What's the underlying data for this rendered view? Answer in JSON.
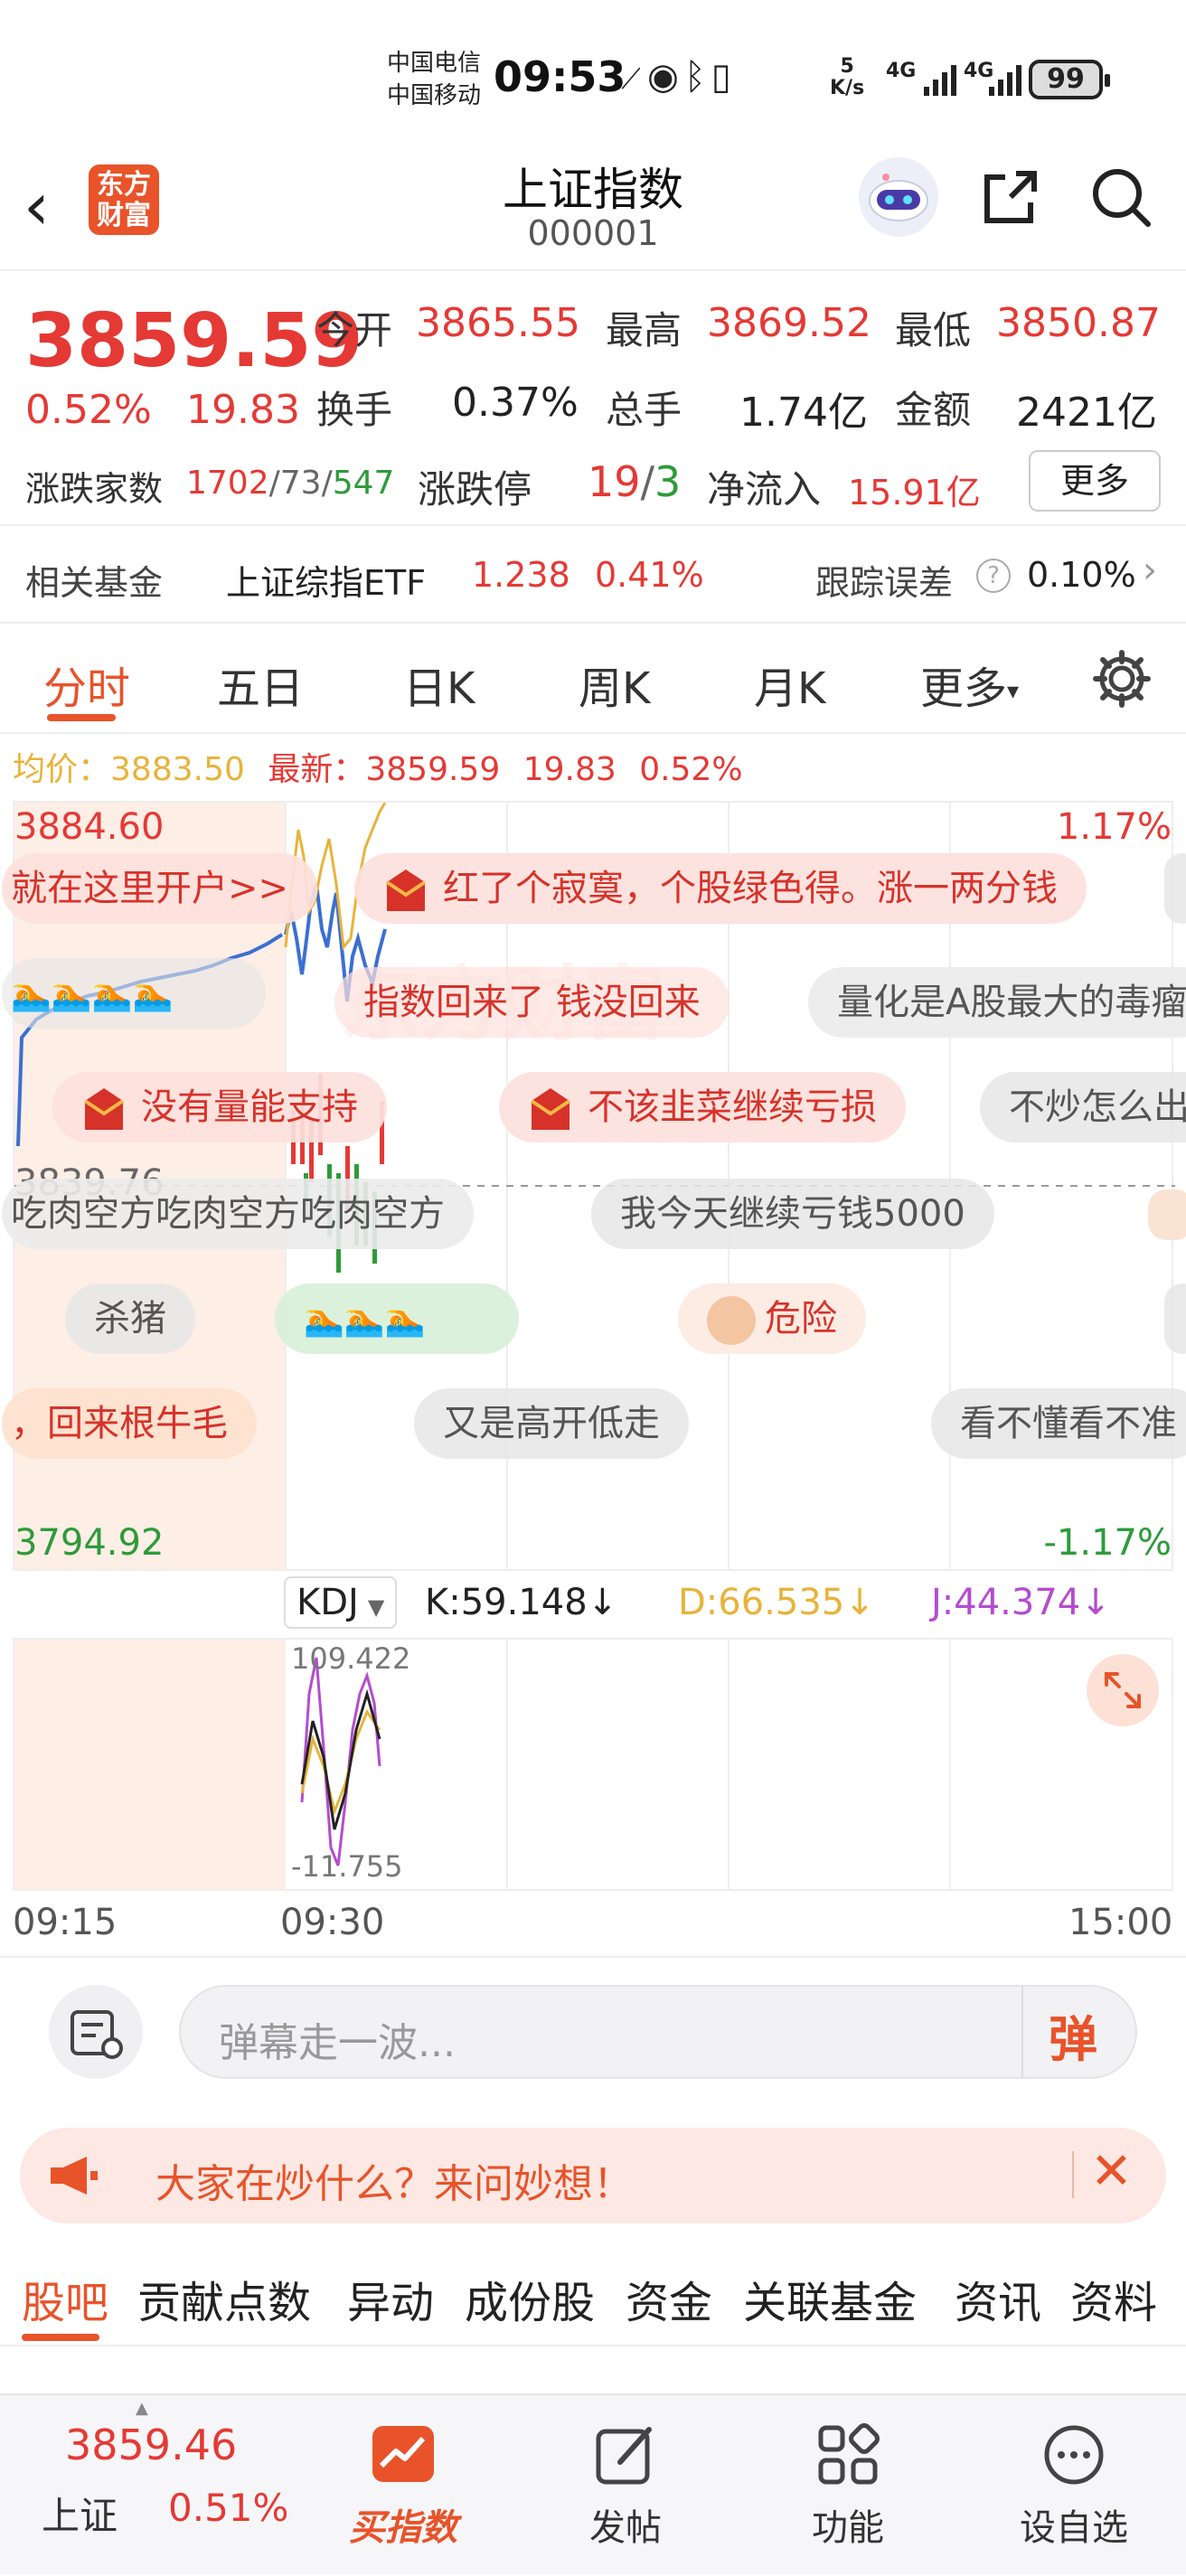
{
  "status_bar": {
    "carrier1": "中国电信",
    "carrier2": "中国移动",
    "time": "09:53",
    "speed_num": "5",
    "speed_unit": "K/s",
    "net1": "4G",
    "net2": "4G",
    "battery": "99"
  },
  "header": {
    "logo_line1": "东方",
    "logo_line2": "财富",
    "title": "上证指数",
    "code": "000001"
  },
  "quote": {
    "price": "3859.59",
    "change_pct": "0.52%",
    "change_pts": "19.83",
    "open_label": "今开",
    "open": "3865.55",
    "high_label": "最高",
    "high": "3869.52",
    "low_label": "最低",
    "low": "3850.87",
    "turnover_label": "换手",
    "turnover": "0.37%",
    "volume_label": "总手",
    "volume": "1.74亿",
    "amount_label": "金额",
    "amount": "2421亿",
    "updown_label": "涨跌家数",
    "up_count": "1702",
    "sep1": "/",
    "flat_count": "73",
    "sep2": "/",
    "down_count": "547",
    "limit_label": "涨跌停",
    "limit_up": "19",
    "limit_sep": "/",
    "limit_down": "3",
    "inflow_label": "净流入",
    "inflow": "15.91亿",
    "more_label": "更多"
  },
  "fund_row": {
    "label": "相关基金",
    "fund_name": "上证综指ETF",
    "fund_price": "1.238",
    "fund_pct": "0.41%",
    "tracking_label": "跟踪误差",
    "tracking_value": "0.10%"
  },
  "tabs": [
    "分时",
    "五日",
    "日K",
    "周K",
    "月K",
    "更多"
  ],
  "avg_line": {
    "avg_label": "均价：",
    "avg_value": "3883.50",
    "latest_label": "最新：",
    "latest_value": "3859.59",
    "latest_pts": "19.83",
    "latest_pct": "0.52%"
  },
  "chart_labels": {
    "top_price": "3884.60",
    "top_pct": "1.17%",
    "mid_price": "3839.76",
    "bottom_price": "3794.92",
    "bottom_pct": "-1.17%",
    "watermark": "东方财富"
  },
  "danmu": [
    {
      "text": "就在这里开户>>",
      "hot": true
    },
    {
      "text": "红了个寂寞，个股绿色得。涨一两分钱",
      "hot": true
    },
    {
      "text": "指数回来了 钱没回来",
      "hot": true
    },
    {
      "text": "量化是A股最大的毒瘤",
      "hot": false
    },
    {
      "text": "没有量能支持",
      "hot": true
    },
    {
      "text": "不该韭菜继续亏损",
      "hot": true
    },
    {
      "text": "不炒怎么出",
      "hot": false
    },
    {
      "text": "吃肉空方吃肉空方吃肉空方",
      "hot": false
    },
    {
      "text": "我今天继续亏钱5000",
      "hot": false
    },
    {
      "text": "杀猪",
      "hot": false
    },
    {
      "text": "危险",
      "hot": true
    },
    {
      "text": "，回来根牛毛",
      "hot": true
    },
    {
      "text": "又是高开低走",
      "hot": false
    },
    {
      "text": "看不懂看不准",
      "hot": false
    }
  ],
  "kdj": {
    "name": "KDJ",
    "k": "K:59.148↓",
    "d": "D:66.535↓",
    "j": "J:44.374↓",
    "top": "109.422",
    "bottom": "-11.755"
  },
  "time_axis": [
    "09:15",
    "09:30",
    "15:00"
  ],
  "danmu_input": {
    "placeholder": "弹幕走一波...",
    "send_label": "弹"
  },
  "ask_banner": {
    "text": "大家在炒什么？来问妙想！"
  },
  "subtabs": [
    "股吧",
    "贡献点数",
    "异动",
    "成份股",
    "资金",
    "关联基金",
    "资讯",
    "资料"
  ],
  "bottom_nav": {
    "index_price": "3859.46",
    "index_name": "上证",
    "index_pct": "0.51%",
    "buy_label": "买指数",
    "post_label": "发帖",
    "func_label": "功能",
    "watch_label": "设自选"
  },
  "colors": {
    "up": "#e53935",
    "down": "#2e9b3a",
    "accent": "#e8532a",
    "avg_line": "#e8b33a",
    "price_line": "#3b6fd1",
    "j_line": "#b44ccf"
  }
}
